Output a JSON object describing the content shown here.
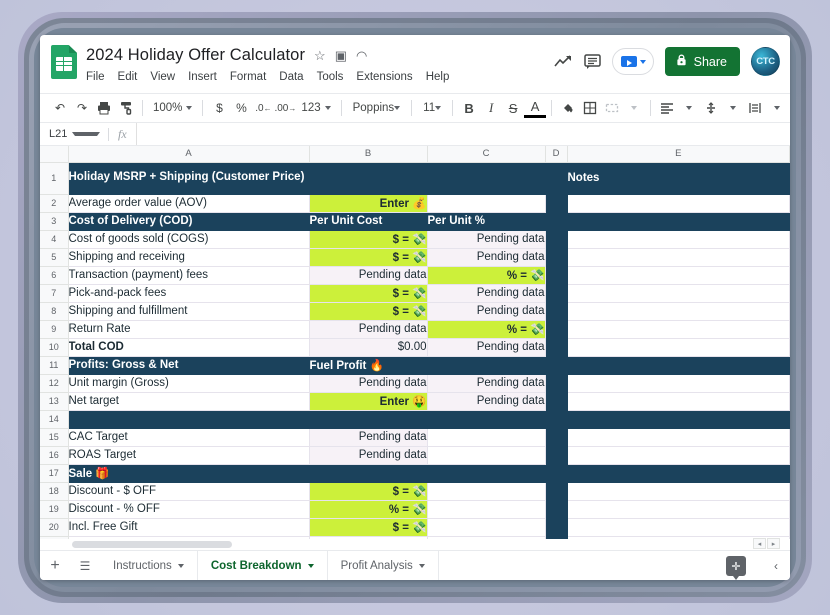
{
  "window": {
    "doc_title": "2024 Holiday Offer Calculator",
    "app": "Google Sheets"
  },
  "header": {
    "star_icon": "☆",
    "move_icon": "▣",
    "cloud_icon": "◠",
    "menus": [
      "File",
      "Edit",
      "View",
      "Insert",
      "Format",
      "Data",
      "Tools",
      "Extensions",
      "Help"
    ],
    "trend_icon": "trending-up-icon",
    "comment_icon": "comment-icon",
    "meet_label": "",
    "share_label": "Share",
    "share_lock_icon": "🔒",
    "avatar_initials": "CTC"
  },
  "toolbar": {
    "undo": "↶",
    "redo": "↷",
    "print": "🖶",
    "paint": "⚟",
    "zoom_value": "100%",
    "currency": "$",
    "percent": "%",
    "dec_dec": ".0",
    "dec_inc": ".00",
    "formats": "123",
    "font_name": "Poppins",
    "font_size": "11",
    "bold": "B",
    "italic": "I",
    "strike": "S",
    "text_color": "A",
    "fill_color": "◔",
    "borders": "▦",
    "merge": "⧉",
    "halign": "≡",
    "valign": "↧",
    "wrap": "↵",
    "rotate": "⤡",
    "link": "🔗"
  },
  "formula_bar": {
    "name_box": "L21",
    "fx_label": "fx",
    "formula_value": ""
  },
  "grid": {
    "columns": [
      "A",
      "B",
      "C",
      "D",
      "E"
    ],
    "rows": [
      {
        "n": "1",
        "tall": true,
        "cells": [
          {
            "v": "Holiday MSRP + Shipping (Customer Price)",
            "s": "navy",
            "two": true
          },
          {
            "v": "",
            "s": "navy"
          },
          {
            "v": "",
            "s": "navy"
          },
          {
            "v": "",
            "s": "navy"
          },
          {
            "v": "Notes",
            "s": "navy"
          }
        ]
      },
      {
        "n": "2",
        "cells": [
          {
            "v": "Average order value (AOV)",
            "s": "white"
          },
          {
            "v": "Enter 💰",
            "s": "lime"
          },
          {
            "v": "",
            "s": "white"
          },
          {
            "v": "",
            "s": "navy"
          },
          {
            "v": "",
            "s": "white"
          }
        ]
      },
      {
        "n": "3",
        "cells": [
          {
            "v": "Cost of Delivery (COD)",
            "s": "navy"
          },
          {
            "v": "Per Unit Cost",
            "s": "navy"
          },
          {
            "v": "Per Unit %",
            "s": "navy"
          },
          {
            "v": "",
            "s": "navy"
          },
          {
            "v": "",
            "s": "navy"
          }
        ]
      },
      {
        "n": "4",
        "cells": [
          {
            "v": "Cost of goods sold (COGS)",
            "s": "white"
          },
          {
            "v": "$ = 💸",
            "s": "lime"
          },
          {
            "v": "Pending data",
            "s": "lav"
          },
          {
            "v": "",
            "s": "navy"
          },
          {
            "v": "",
            "s": "white"
          }
        ]
      },
      {
        "n": "5",
        "cells": [
          {
            "v": "Shipping and receiving",
            "s": "white"
          },
          {
            "v": "$ = 💸",
            "s": "lime"
          },
          {
            "v": "Pending data",
            "s": "lav"
          },
          {
            "v": "",
            "s": "navy"
          },
          {
            "v": "",
            "s": "white"
          }
        ]
      },
      {
        "n": "6",
        "cells": [
          {
            "v": "Transaction (payment) fees",
            "s": "white"
          },
          {
            "v": "Pending data",
            "s": "lav"
          },
          {
            "v": "% = 💸",
            "s": "lime"
          },
          {
            "v": "",
            "s": "navy"
          },
          {
            "v": "",
            "s": "white"
          }
        ]
      },
      {
        "n": "7",
        "cells": [
          {
            "v": "Pick-and-pack fees",
            "s": "white"
          },
          {
            "v": "$ = 💸",
            "s": "lime"
          },
          {
            "v": "Pending data",
            "s": "lav"
          },
          {
            "v": "",
            "s": "navy"
          },
          {
            "v": "",
            "s": "white"
          }
        ]
      },
      {
        "n": "8",
        "cells": [
          {
            "v": "Shipping and fulfillment",
            "s": "white"
          },
          {
            "v": "$ = 💸",
            "s": "lime"
          },
          {
            "v": "Pending data",
            "s": "lav"
          },
          {
            "v": "",
            "s": "navy"
          },
          {
            "v": "",
            "s": "white"
          }
        ]
      },
      {
        "n": "9",
        "cells": [
          {
            "v": "Return Rate",
            "s": "white"
          },
          {
            "v": "Pending data",
            "s": "lav"
          },
          {
            "v": "% = 💸",
            "s": "lime"
          },
          {
            "v": "",
            "s": "navy"
          },
          {
            "v": "",
            "s": "white"
          }
        ]
      },
      {
        "n": "10",
        "cells": [
          {
            "v": "Total COD",
            "s": "white bold"
          },
          {
            "v": "$0.00",
            "s": "lav"
          },
          {
            "v": "Pending data",
            "s": "lav"
          },
          {
            "v": "",
            "s": "navy"
          },
          {
            "v": "",
            "s": "white"
          }
        ]
      },
      {
        "n": "11",
        "cells": [
          {
            "v": "Profits: Gross & Net",
            "s": "navy"
          },
          {
            "v": "Fuel Profit 🔥",
            "s": "navy"
          },
          {
            "v": "",
            "s": "navy"
          },
          {
            "v": "",
            "s": "navy"
          },
          {
            "v": "",
            "s": "navy"
          }
        ]
      },
      {
        "n": "12",
        "cells": [
          {
            "v": "Unit margin (Gross)",
            "s": "white"
          },
          {
            "v": "Pending data",
            "s": "lav"
          },
          {
            "v": "Pending data",
            "s": "lav"
          },
          {
            "v": "",
            "s": "navy"
          },
          {
            "v": "",
            "s": "white"
          }
        ]
      },
      {
        "n": "13",
        "cells": [
          {
            "v": "Net target",
            "s": "white"
          },
          {
            "v": "Enter 🤑",
            "s": "lime"
          },
          {
            "v": "Pending data",
            "s": "lav"
          },
          {
            "v": "",
            "s": "navy"
          },
          {
            "v": "",
            "s": "white"
          }
        ]
      },
      {
        "n": "14",
        "cells": [
          {
            "v": "",
            "s": "navy"
          },
          {
            "v": "",
            "s": "navy"
          },
          {
            "v": "",
            "s": "navy"
          },
          {
            "v": "",
            "s": "navy"
          },
          {
            "v": "",
            "s": "navy"
          }
        ]
      },
      {
        "n": "15",
        "cells": [
          {
            "v": "CAC Target",
            "s": "white"
          },
          {
            "v": "Pending data",
            "s": "lav"
          },
          {
            "v": "",
            "s": "white"
          },
          {
            "v": "",
            "s": "navy"
          },
          {
            "v": "",
            "s": "white"
          }
        ]
      },
      {
        "n": "16",
        "cells": [
          {
            "v": "ROAS Target",
            "s": "white"
          },
          {
            "v": "Pending data",
            "s": "lav"
          },
          {
            "v": "",
            "s": "white"
          },
          {
            "v": "",
            "s": "navy"
          },
          {
            "v": "",
            "s": "white"
          }
        ]
      },
      {
        "n": "17",
        "cells": [
          {
            "v": "Sale 🎁",
            "s": "navy"
          },
          {
            "v": "",
            "s": "navy"
          },
          {
            "v": "",
            "s": "navy"
          },
          {
            "v": "",
            "s": "navy"
          },
          {
            "v": "",
            "s": "navy"
          }
        ]
      },
      {
        "n": "18",
        "cells": [
          {
            "v": "Discount - $ OFF",
            "s": "white"
          },
          {
            "v": "$ = 💸",
            "s": "lime"
          },
          {
            "v": "",
            "s": "white"
          },
          {
            "v": "",
            "s": "navy"
          },
          {
            "v": "",
            "s": "white"
          }
        ]
      },
      {
        "n": "19",
        "cells": [
          {
            "v": "Discount - % OFF",
            "s": "white"
          },
          {
            "v": "% = 💸",
            "s": "lime"
          },
          {
            "v": "",
            "s": "white"
          },
          {
            "v": "",
            "s": "navy"
          },
          {
            "v": "",
            "s": "white"
          }
        ]
      },
      {
        "n": "20",
        "cells": [
          {
            "v": "Incl. Free Gift",
            "s": "white"
          },
          {
            "v": "$ = 💸",
            "s": "lime"
          },
          {
            "v": "",
            "s": "white"
          },
          {
            "v": "",
            "s": "navy"
          },
          {
            "v": "",
            "s": "white"
          }
        ]
      },
      {
        "n": "21",
        "cells": [
          {
            "v": "",
            "s": "white"
          },
          {
            "v": "",
            "s": "white"
          },
          {
            "v": "",
            "s": "white"
          },
          {
            "v": "",
            "s": "navy"
          },
          {
            "v": "",
            "s": "white"
          }
        ]
      }
    ]
  },
  "sheet_bar": {
    "add_sheet_icon": "+",
    "all_sheets_icon": "☰",
    "tabs": [
      {
        "label": "Instructions",
        "active": false
      },
      {
        "label": "Cost Breakdown",
        "active": true
      },
      {
        "label": "Profit Analysis",
        "active": false
      }
    ],
    "addon_icon": "✛",
    "collapse_icon": "‹",
    "scroll_left": "◂",
    "scroll_right": "▸"
  },
  "colors": {
    "navy": "#1b425c",
    "lime": "#ccf03a",
    "lavender": "#f7f2f7",
    "sheets_green": "#23a566",
    "share_green": "#137333",
    "tab_active": "#0d652d"
  }
}
